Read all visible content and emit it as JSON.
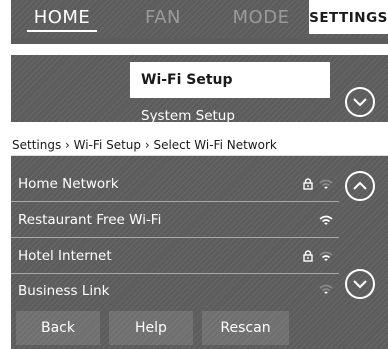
{
  "tabs": {
    "home": "HOME",
    "fan": "FAN",
    "mode": "MODE",
    "settings": "SETTINGS"
  },
  "menu": {
    "wifi_setup": "Wi-Fi Setup",
    "system_setup": "System Setup"
  },
  "wifi": {
    "breadcrumb": "Settings › Wi-Fi Setup › Select Wi-Fi Network",
    "networks": [
      {
        "name": "Home Network",
        "locked": true,
        "signal": "weak"
      },
      {
        "name": "Restaurant Free Wi-Fi",
        "locked": false,
        "signal": "strong"
      },
      {
        "name": "Hotel Internet",
        "locked": true,
        "signal": "medium"
      },
      {
        "name": "Business Link",
        "locked": false,
        "signal": "weak"
      }
    ]
  },
  "buttons": {
    "back": "Back",
    "help": "Help",
    "rescan": "Rescan"
  },
  "colors": {
    "panel": "#5c5c5c",
    "selected_bg": "#ffffff",
    "text": "#ffffff"
  }
}
